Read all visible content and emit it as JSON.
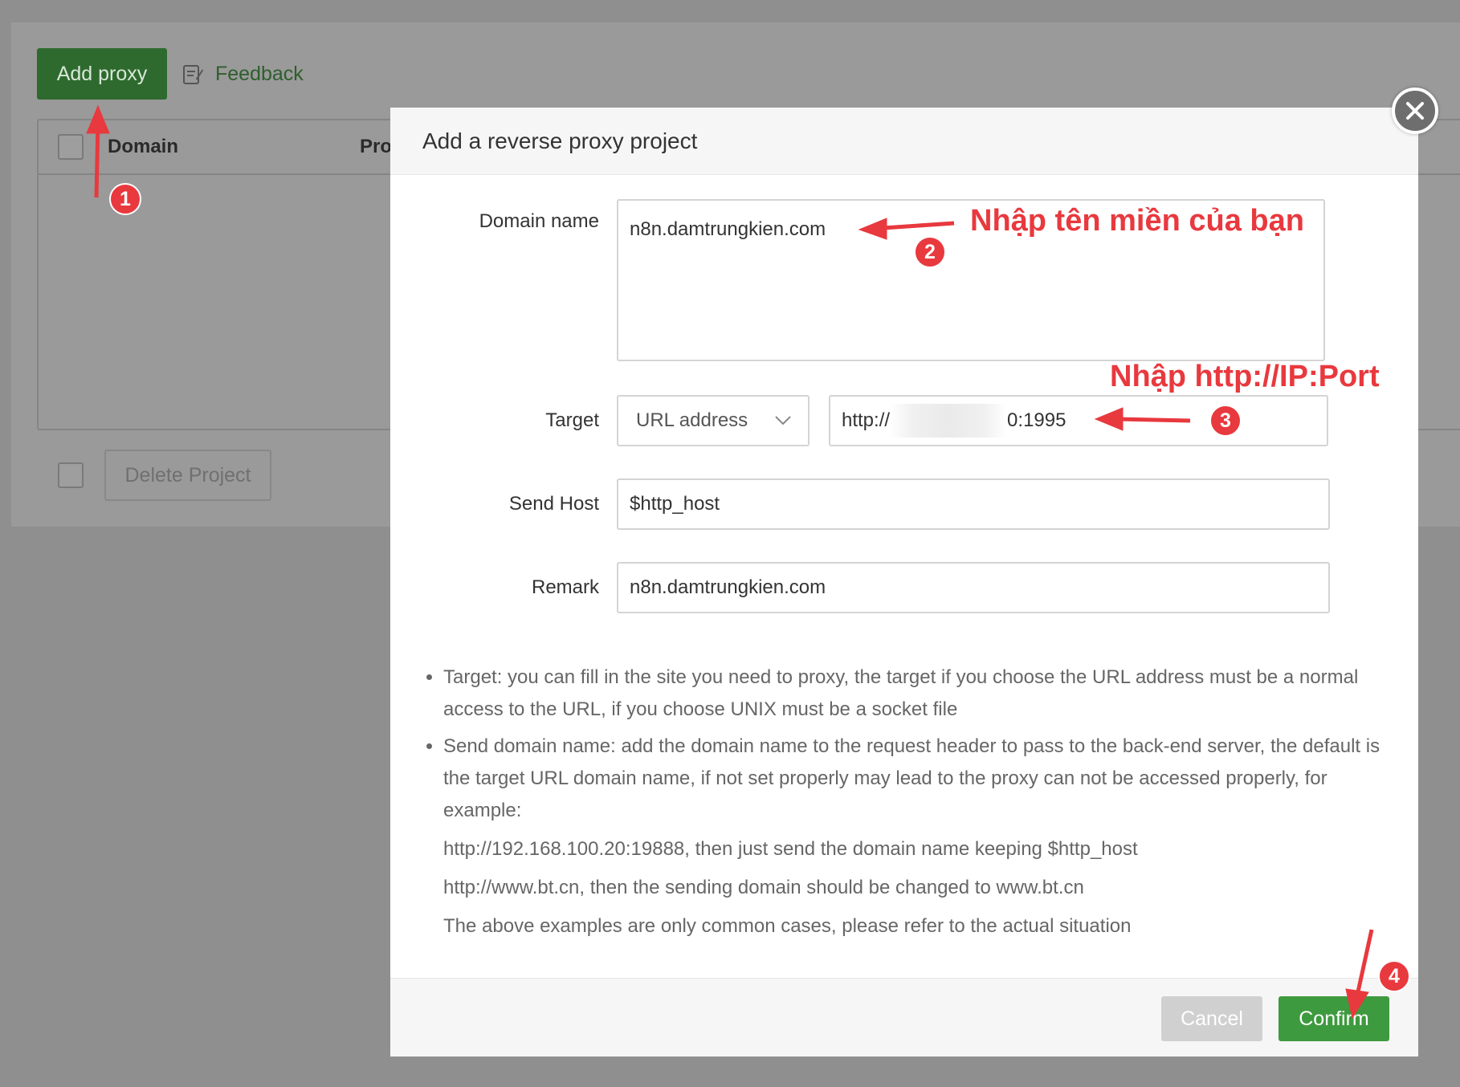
{
  "toolbar": {
    "add_proxy": "Add proxy",
    "feedback": "Feedback"
  },
  "table": {
    "col_domain": "Domain",
    "col_pro": "Pro"
  },
  "footer": {
    "delete_project": "Delete Project"
  },
  "dialog": {
    "title": "Add a reverse proxy project",
    "domain_label": "Domain name",
    "domain_value": "n8n.damtrungkien.com",
    "target_label": "Target",
    "target_type": "URL address",
    "target_prefix": "http://",
    "target_suffix": "0:1995",
    "send_host_label": "Send Host",
    "send_host_value": "$http_host",
    "remark_label": "Remark",
    "remark_value": "n8n.damtrungkien.com",
    "help": {
      "item1": "Target: you can fill in the site you need to proxy, the target if you choose the URL address must be a normal access to the URL, if you choose UNIX must be a socket file",
      "item2": "Send domain name: add the domain name to the request header to pass to the back-end server, the default is the target URL domain name, if not set properly may lead to the proxy can not be accessed properly, for example:",
      "example1": "http://192.168.100.20:19888, then just send the domain name keeping $http_host",
      "example2": "http://www.bt.cn, then the sending domain should be changed to www.bt.cn",
      "note": "The above examples are only common cases, please refer to the actual situation"
    },
    "cancel": "Cancel",
    "confirm": "Confirm"
  },
  "annotations": {
    "text_domain": "Nhập tên miền của bạn",
    "text_target": "Nhập http://IP:Port",
    "badge1": "1",
    "badge2": "2",
    "badge3": "3",
    "badge4": "4",
    "color": "#e8393e"
  }
}
